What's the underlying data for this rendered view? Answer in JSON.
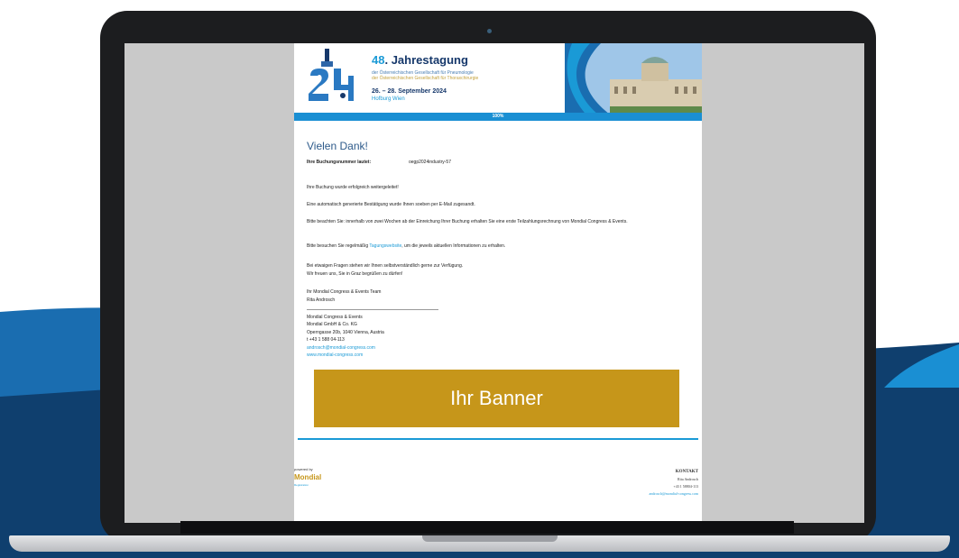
{
  "header": {
    "title_number": "48",
    "title_rest": ". Jahrestagung",
    "subtitle_1": "der Österreichischen Gesellschaft für Pneumologie",
    "subtitle_2": "der Österreichischen Gesellschaft für Thoraxchirurgie",
    "date": "26. – 28. September 2024",
    "location": "Hofburg Wien",
    "progress_label": "100%",
    "progress_value": 1.0
  },
  "confirmation": {
    "title": "Vielen Dank!",
    "booking_label": "Ihre Buchungsnummer lautet:",
    "booking_value": "oegp2024industry-57",
    "p1": "Ihre Buchung wurde erfolgreich weitergeleitet!",
    "p2": "Eine automatisch generierte Bestätigung wurde Ihnen soeben per E-Mail zugesandt.",
    "p3": "Bitte beachten Sie: innerhalb von zwei Wochen ab der Einreichung Ihrer Buchung erhalten Sie eine erste Teilzahlungsrechnung von Mondial Congress & Events.",
    "p4_before": "Bitte besuchen Sie regelmäßig ",
    "p4_link": "Tagungswebsite",
    "p4_after": ", um die jeweils aktuellen Informationen zu erhalten.",
    "p5_line1": "Bei etwaigen Fragen stehen wir Ihnen selbstverständlich gerne zur Verfügung.",
    "p5_line2": "Wir freuen uns, Sie in Graz begrüßen zu dürfen!",
    "team_line": "Ihr Mondial Congress & Events Team",
    "team_name": "Rita Androsch"
  },
  "signature": {
    "company": "Mondial Congress & Events",
    "legal": "Mondial GmbH & Co. KG",
    "address": "Operngasse 20b, 1040 Vienna, Austria",
    "phone": "t +43 1 588 04-113",
    "email": "androsch@mondial-congress.com",
    "website": "www.mondial-congress.com"
  },
  "banner": {
    "label": "Ihr Banner",
    "color": "#c6961a"
  },
  "footer": {
    "powered_by": "powered by",
    "brand": "Mondial",
    "brand_sub": "Registration",
    "contact_title": "KONTAKT",
    "contact_name": "Rita Androsch",
    "contact_phone": "+43 1 58804-113",
    "contact_email": "androsch@mondial-congress.com"
  },
  "colors": {
    "accent_blue": "#1a9ad6",
    "navy": "#16386b",
    "gold": "#c6961a"
  }
}
